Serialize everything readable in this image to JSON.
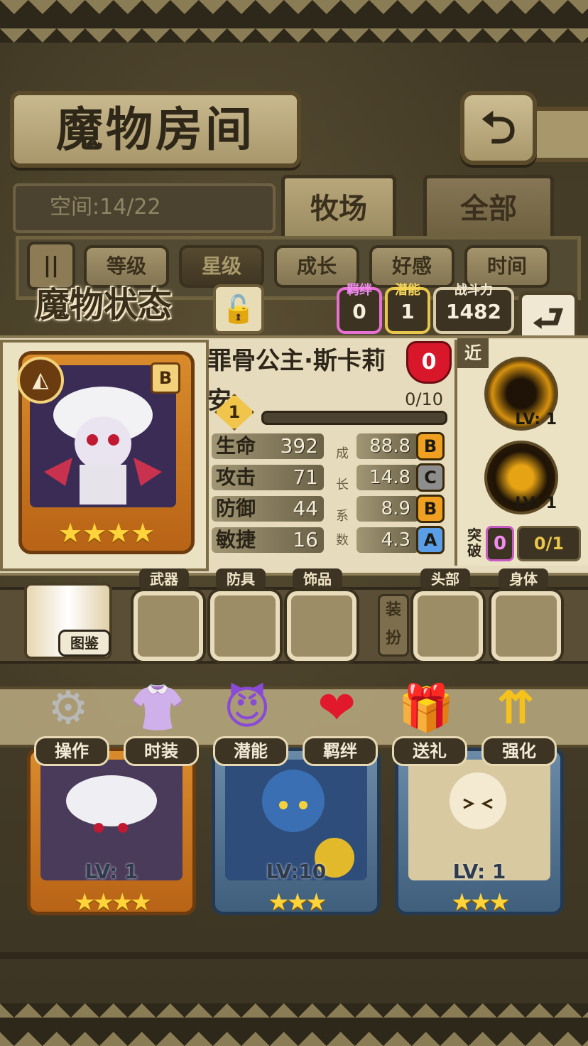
{
  "header": {
    "title": "魔物房间",
    "back_icon": "⮌"
  },
  "space": {
    "label": "空间:14/22"
  },
  "tabs": [
    {
      "label": "牧场",
      "active": true
    },
    {
      "label": "全部",
      "active": false
    }
  ],
  "filters": {
    "toggle_icon": "||",
    "items": [
      {
        "label": "等级",
        "active": false
      },
      {
        "label": "星级",
        "active": true
      },
      {
        "label": "成长",
        "active": false
      },
      {
        "label": "好感",
        "active": false
      },
      {
        "label": "时间",
        "active": false
      }
    ]
  },
  "status": {
    "title": "魔物状态",
    "bond": {
      "label": "羁绊",
      "value": "0"
    },
    "potential": {
      "label": "潜能",
      "value": "1"
    },
    "power": {
      "label": "战斗力",
      "value": "1482"
    },
    "share_icon": "⮐"
  },
  "monster": {
    "name": "罪骨公主·斯卡莉安",
    "affection": "0",
    "rank": "B",
    "stars": 4,
    "level": "1",
    "exp": "0/10",
    "range": "近",
    "stats": [
      {
        "label": "生命",
        "value": "392",
        "growth": "88.8",
        "grade": "B",
        "grade_color": "#f0a020"
      },
      {
        "label": "攻击",
        "value": "71",
        "growth": "14.8",
        "grade": "C",
        "grade_color": "#8d8d8d"
      },
      {
        "label": "防御",
        "value": "44",
        "growth": "8.9",
        "grade": "B",
        "grade_color": "#f0a020"
      },
      {
        "label": "敏捷",
        "value": "16",
        "growth": "4.3",
        "grade": "A",
        "grade_color": "#5a9ee8"
      }
    ],
    "growth_label": [
      "成",
      "长",
      "系",
      "数"
    ],
    "skills": [
      {
        "level": "LV: 1"
      },
      {
        "level": "LV: 1"
      }
    ],
    "breakthrough": {
      "label": "突破",
      "value": "0",
      "count": "0/1"
    }
  },
  "equipment": {
    "book_label": "图鉴",
    "dress_label": "装扮",
    "slots": [
      "武器",
      "防具",
      "饰品",
      "头部",
      "身体"
    ]
  },
  "actions": [
    {
      "label": "操作",
      "icon": "⚙"
    },
    {
      "label": "时装",
      "icon": "👚"
    },
    {
      "label": "潜能",
      "icon": "😈"
    },
    {
      "label": "羁绊",
      "icon": "❤"
    },
    {
      "label": "送礼",
      "icon": "🎁"
    },
    {
      "label": "强化",
      "icon": "⇈"
    }
  ],
  "roster": [
    {
      "level": "LV: 1",
      "stars": "★★★★",
      "frame": "orange"
    },
    {
      "level": "LV:10",
      "stars": "★★★",
      "frame": "blue"
    },
    {
      "level": "LV: 1",
      "stars": "★★★",
      "frame": "blue"
    }
  ]
}
